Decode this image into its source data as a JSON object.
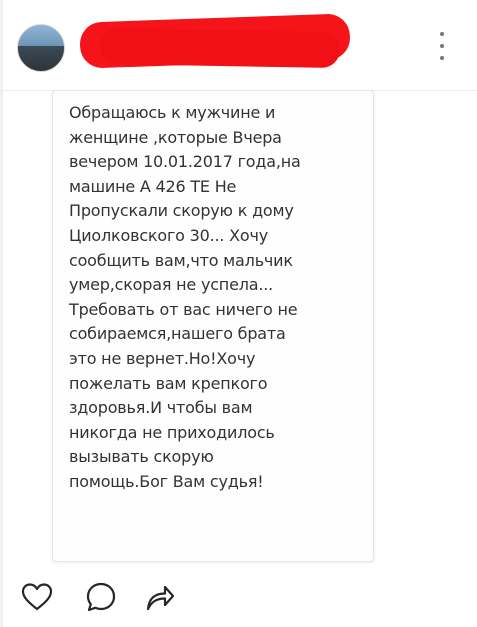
{
  "header": {
    "avatar_text": "",
    "username": "",
    "more_icon": "more-vertical-icon"
  },
  "post": {
    "lines": [
      "Обращаюсь к мужчине и",
      "женщине ,которые Вчера",
      "вечером 10.01.2017 года,на",
      "машине А 426 ТЕ  Не",
      "Пропускали скорую к дому",
      "Циолковского 30... Хочу",
      "сообщить вам,что мальчик",
      "умер,скорая не успела...",
      "Требовать от вас ничего не",
      "собираемся,нашего брата",
      "это не вернет.Но!Хочу",
      "пожелать вам крепкого",
      "здоровья.И чтобы вам",
      "никогда не приходилось",
      "вызывать скорую",
      "помощь.Бог Вам судья!"
    ]
  },
  "actions": {
    "icons": [
      "heart-icon",
      "comment-icon",
      "share-icon"
    ]
  },
  "colors": {
    "redaction": "#f5141a",
    "text": "#333333",
    "icon": "#262626"
  }
}
